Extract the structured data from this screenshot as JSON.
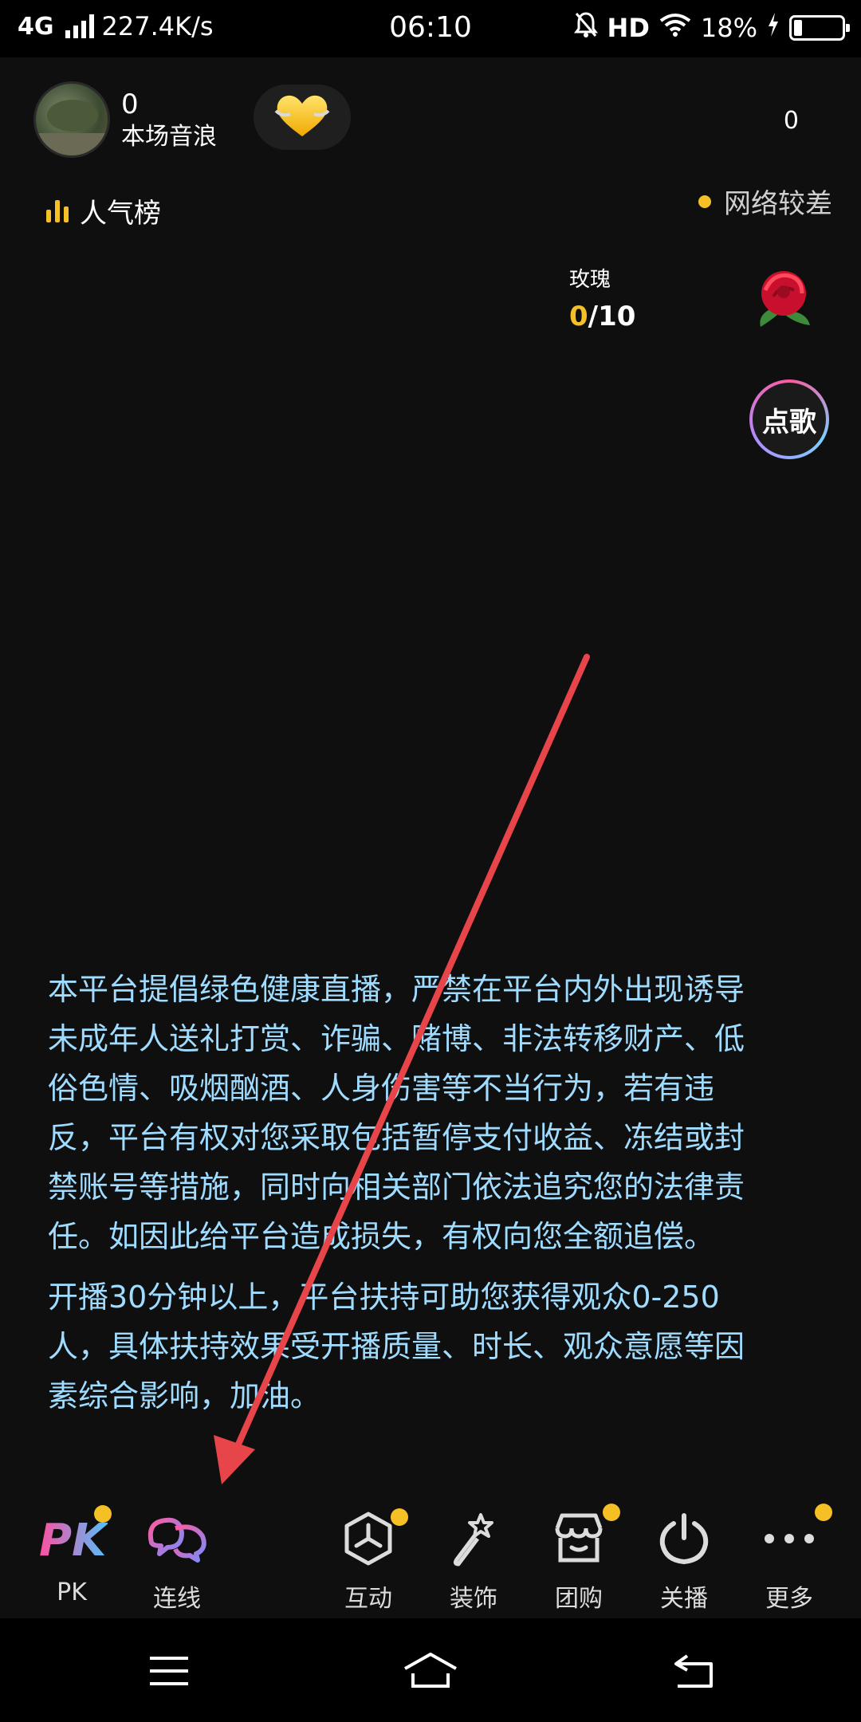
{
  "status_bar": {
    "network": "4G",
    "speed": "227.4K/s",
    "time": "06:10",
    "hd": "HD",
    "battery": "18%"
  },
  "host": {
    "sound_wave_count": "0",
    "sound_wave_label": "本场音浪"
  },
  "viewer_count": "0",
  "rank_label": "人气榜",
  "network_status": "网络较差",
  "rose_task": {
    "label": "玫瑰",
    "current": "0",
    "separator": "/",
    "target": "10"
  },
  "song_button_label": "点歌",
  "notice": {
    "paragraph1": "本平台提倡绿色健康直播，严禁在平台内外出现诱导未成年人送礼打赏、诈骗、赌博、非法转移财产、低俗色情、吸烟酗酒、人身伤害等不当行为，若有违反，平台有权对您采取包括暂停支付收益、冻结或封禁账号等措施，同时向相关部门依法追究您的法律责任。如因此给平台造成损失，有权向您全额追偿。",
    "paragraph2": "开播30分钟以上，平台扶持可助您获得观众0-250人，具体扶持效果受开播质量、时长、观众意愿等因素综合影响，加油。"
  },
  "toolbar": {
    "pk": "PK",
    "link": "连线",
    "interact": "互动",
    "decorate": "装饰",
    "group_buy": "团购",
    "end_live": "关播",
    "more": "更多"
  },
  "colors": {
    "accent_yellow": "#f5c026",
    "notice_text": "#9fdcff",
    "arrow": "#e8454a"
  }
}
